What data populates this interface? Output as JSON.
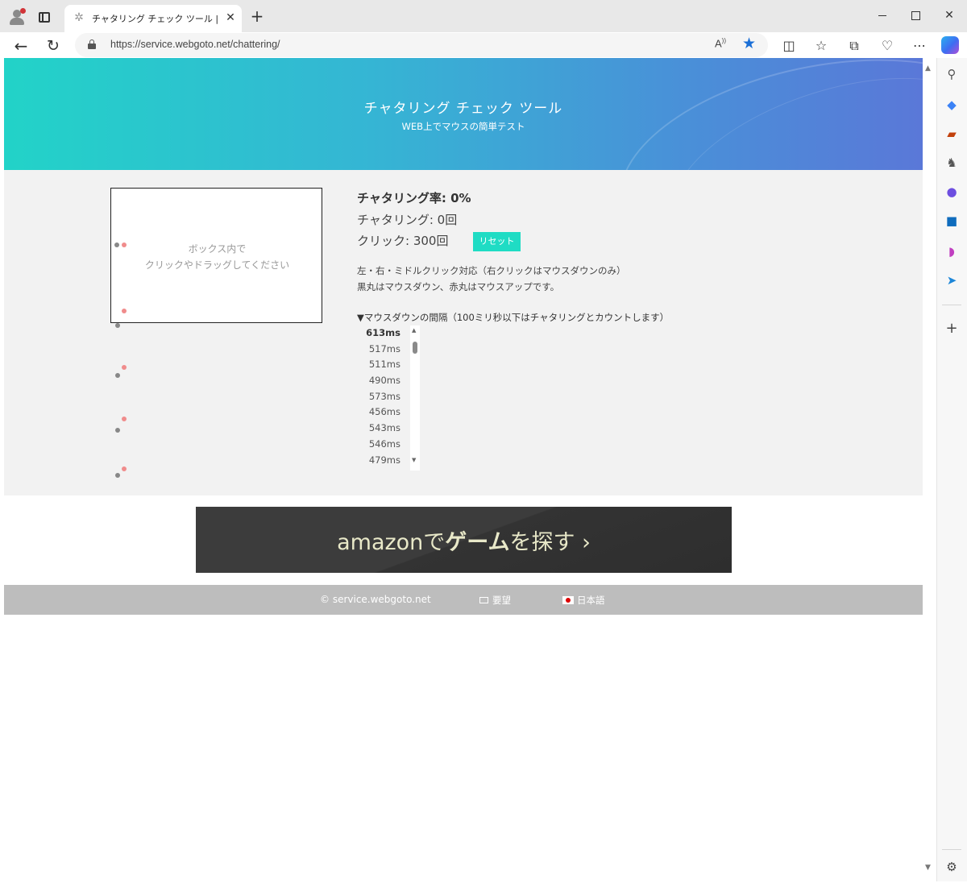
{
  "browser": {
    "tab_title": "チャタリング チェック ツール | WEB上で",
    "new_tab_symbol": "+",
    "close_tab_symbol": "✕",
    "url": "https://service.webgoto.net/chattering/",
    "read_aloud": "Á̀",
    "icons": [
      "profile-icon",
      "tab-actions-icon",
      "back-icon",
      "refresh-icon",
      "lock-icon",
      "read-aloud-icon",
      "favorite-star-icon",
      "split-screen-icon",
      "favorites-icon",
      "collections-icon",
      "browser-essentials-icon",
      "more-icon",
      "copilot-icon"
    ],
    "accent_color": "#1a6fd6"
  },
  "sidebar": {
    "icons": [
      "search-icon",
      "shopping-icon",
      "tools-icon",
      "games-icon",
      "microsoft365-icon",
      "outlook-icon",
      "designer-icon",
      "send-icon",
      "add-icon",
      "settings-icon"
    ]
  },
  "hero": {
    "title": "チャタリング チェック ツール",
    "subtitle": "WEB上でマウスの簡単テスト"
  },
  "testbox": {
    "line1": "ボックス内で",
    "line2": "クリックやドラッグしてください"
  },
  "stats": {
    "rate": "チャタリング率: 0%",
    "count": "チャタリング: 0回",
    "clicks": "クリック: 300回",
    "reset_label": "リセット",
    "reset_color": "#1fdcc4"
  },
  "notes": {
    "line1": "左・右・ミドルクリック対応（右クリックはマウスダウンのみ）",
    "line2": "黒丸はマウスダウン、赤丸はマウスアップです。",
    "intervals_title": "▼マウスダウンの間隔（100ミリ秒以下はチャタリングとカウントします）"
  },
  "intervals": [
    "613ms",
    "517ms",
    "511ms",
    "490ms",
    "573ms",
    "456ms",
    "543ms",
    "546ms",
    "479ms"
  ],
  "banner": {
    "part1": "amazonで",
    "part2": "ゲーム",
    "part3": "を探す ›"
  },
  "footer": {
    "copyright": "© service.webgoto.net",
    "request": "要望",
    "language": "日本語"
  }
}
